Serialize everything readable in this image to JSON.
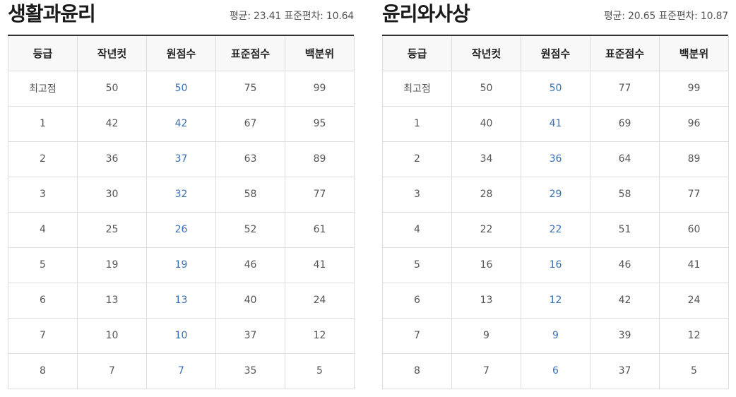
{
  "columns": [
    "등급",
    "작년컷",
    "원점수",
    "표준점수",
    "백분위"
  ],
  "tables": [
    {
      "subject": "생활과윤리",
      "mean_label": "평균:",
      "mean": "23.41",
      "sd_label": "표준편차:",
      "sd": "10.64",
      "rows": [
        [
          "최고점",
          "50",
          "50",
          "75",
          "99"
        ],
        [
          "1",
          "42",
          "42",
          "67",
          "95"
        ],
        [
          "2",
          "36",
          "37",
          "63",
          "89"
        ],
        [
          "3",
          "30",
          "32",
          "58",
          "77"
        ],
        [
          "4",
          "25",
          "26",
          "52",
          "61"
        ],
        [
          "5",
          "19",
          "19",
          "46",
          "41"
        ],
        [
          "6",
          "13",
          "13",
          "40",
          "24"
        ],
        [
          "7",
          "10",
          "10",
          "37",
          "12"
        ],
        [
          "8",
          "7",
          "7",
          "35",
          "5"
        ]
      ]
    },
    {
      "subject": "윤리와사상",
      "mean_label": "평균:",
      "mean": "20.65",
      "sd_label": "표준편차:",
      "sd": "10.87",
      "rows": [
        [
          "최고점",
          "50",
          "50",
          "77",
          "99"
        ],
        [
          "1",
          "40",
          "41",
          "69",
          "96"
        ],
        [
          "2",
          "34",
          "36",
          "64",
          "89"
        ],
        [
          "3",
          "28",
          "29",
          "58",
          "77"
        ],
        [
          "4",
          "22",
          "22",
          "51",
          "60"
        ],
        [
          "5",
          "16",
          "16",
          "46",
          "41"
        ],
        [
          "6",
          "13",
          "12",
          "42",
          "24"
        ],
        [
          "7",
          "9",
          "9",
          "39",
          "12"
        ],
        [
          "8",
          "7",
          "6",
          "37",
          "5"
        ]
      ]
    }
  ],
  "colors": {
    "raw_score": "#3a6fb5",
    "header_bg": "#f8f8f8",
    "border": "#dddddd",
    "title_rule": "#333333"
  }
}
